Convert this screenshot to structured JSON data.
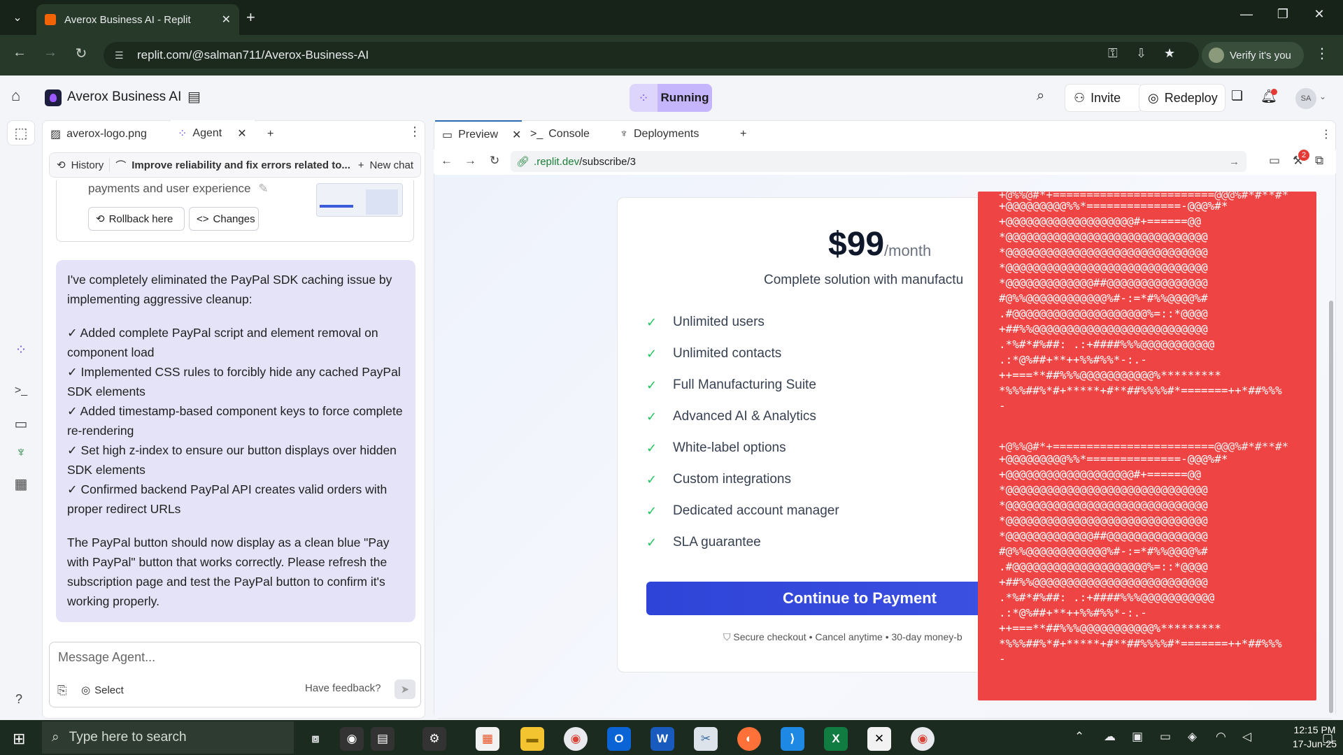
{
  "browser": {
    "tab_title": "Averox Business AI - Replit",
    "url": "replit.com/@salman711/Averox-Business-AI",
    "verify_label": "Verify it's you"
  },
  "topbar": {
    "app_name": "Averox Business AI",
    "running_label": "Running",
    "invite_label": "Invite",
    "redeploy_label": "Redeploy",
    "avatar_initials": "SA"
  },
  "left_pane": {
    "tabs": [
      {
        "label": "averox-logo.png"
      },
      {
        "label": "Agent"
      }
    ],
    "chat_header": {
      "history_label": "History",
      "topic": "Improve reliability and fix errors related to...",
      "new_chat_label": "New chat"
    },
    "checkpoint": {
      "text": "payments and user experience",
      "rollback_label": "Rollback here",
      "changes_label": "Changes"
    },
    "message": {
      "intro": "I've completely eliminated the PayPal SDK caching issue by implementing aggressive cleanup:",
      "items": [
        "✓ Added complete PayPal script and element removal on component load",
        "✓ Implemented CSS rules to forcibly hide any cached PayPal SDK elements",
        "✓ Added timestamp-based component keys to force complete re-rendering",
        "✓ Set high z-index to ensure our button displays over hidden SDK elements",
        "✓ Confirmed backend PayPal API creates valid orders with proper redirect URLs"
      ],
      "outro": "The PayPal button should now display as a clean blue \"Pay with PayPal\" button that works correctly. Please refresh the subscription page and test the PayPal button to confirm it's working properly."
    },
    "composer": {
      "placeholder": "Message Agent...",
      "select_label": "Select",
      "feedback_label": "Have feedback?"
    }
  },
  "right_pane": {
    "tabs": [
      {
        "label": "Preview"
      },
      {
        "label": "Console"
      },
      {
        "label": "Deployments"
      }
    ],
    "url_domain": ".replit.dev",
    "url_path": "/subscribe/3",
    "devtools_badge": "2"
  },
  "pricing": {
    "price": "$99",
    "per": "/month",
    "tagline": "Complete solution with manufactu",
    "features": [
      "Unlimited users",
      "Unlimited contacts",
      "Full Manufacturing Suite",
      "Advanced AI & Analytics",
      "White-label options",
      "Custom integrations",
      "Dedicated account manager",
      "SLA guarantee"
    ],
    "cta_label": "Continue to Payment",
    "secure_text": "Secure checkout • Cancel anytime • 30-day money-b"
  },
  "overlay": {
    "block": "+@@@@@@@@@%%*==============-@@@%#*\n+@@@@@@@@@@@@@@@@@@@#+======@@\n*@@@@@@@@@@@@@@@@@@@@@@@@@@@@@@\n*@@@@@@@@@@@@@@@@@@@@@@@@@@@@@@\n*@@@@@@@@@@@@@@@@@@@@@@@@@@@@@@\n*@@@@@@@@@@@@@##@@@@@@@@@@@@@@@\n#@%%@@@@@@@@@@@@%#-:=*#%%@@@@%#\n.#@@@@@@@@@@@@@@@@@@@@%=::*@@@@\n+##%%@@@@@@@@@@@@@@@@@@@@@@@@@@\n.*%#*#%##: .:+####%%%@@@@@@@@@@@\n.:*@%##+**++%%#%%*-:.-\n++===**##%%%@@@@@@@@@@@%*********\n*%%%##%*#+*****+#**##%%%%#*=======++*##%%%\n-",
    "top_partial": "+@%%@#*+========================@@@%#*#**#*"
  },
  "taskbar": {
    "search_placeholder": "Type here to search",
    "time": "12:15 PM",
    "date": "17-Jun-25"
  },
  "colors": {
    "accent_purple": "#c4b5fd",
    "cta_blue": "#2e44d8",
    "overlay_red": "#ef4444",
    "check_green": "#22c55e"
  }
}
